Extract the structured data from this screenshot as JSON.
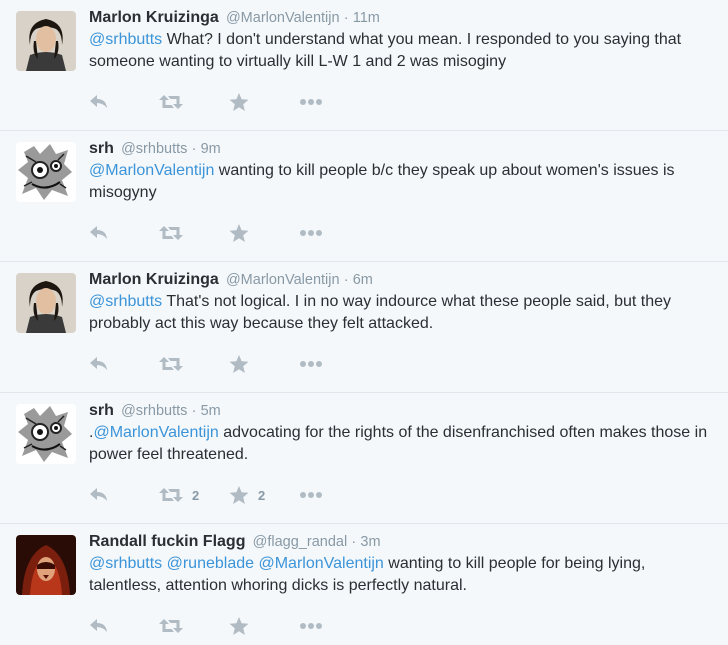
{
  "tweets": [
    {
      "name": "Marlon Kruizinga",
      "handle": "@MarlonValentijn",
      "time": "11m",
      "avatar": "avatar-marlon",
      "segments": [
        {
          "text": "@srhbutts",
          "mention": true
        },
        {
          "text": " What? I don't understand what you mean. I responded to you saying that someone wanting to virtually kill L-W 1 and 2 was misoginy",
          "mention": false
        }
      ],
      "retweets": "",
      "favorites": ""
    },
    {
      "name": "srh",
      "handle": "@srhbutts",
      "time": "9m",
      "avatar": "avatar-srh",
      "segments": [
        {
          "text": "@MarlonValentijn",
          "mention": true
        },
        {
          "text": " wanting to kill people b/c they speak up about women's issues is misogyny",
          "mention": false
        }
      ],
      "retweets": "",
      "favorites": ""
    },
    {
      "name": "Marlon Kruizinga",
      "handle": "@MarlonValentijn",
      "time": "6m",
      "avatar": "avatar-marlon",
      "segments": [
        {
          "text": "@srhbutts",
          "mention": true
        },
        {
          "text": " That's not logical. I in no way indource what these people said, but they probably act this way because they felt attacked.",
          "mention": false
        }
      ],
      "retweets": "",
      "favorites": ""
    },
    {
      "name": "srh",
      "handle": "@srhbutts",
      "time": "5m",
      "avatar": "avatar-srh",
      "segments": [
        {
          "text": ".",
          "mention": false
        },
        {
          "text": "@MarlonValentijn",
          "mention": true
        },
        {
          "text": " advocating for the rights of the disenfranchised often makes those in power feel threatened.",
          "mention": false
        }
      ],
      "retweets": "2",
      "favorites": "2"
    },
    {
      "name": "Randall fuckin Flagg",
      "handle": "@flagg_randal",
      "time": "3m",
      "avatar": "avatar-randall",
      "segments": [
        {
          "text": "@srhbutts",
          "mention": true
        },
        {
          "text": " ",
          "mention": false
        },
        {
          "text": "@runeblade",
          "mention": true
        },
        {
          "text": " ",
          "mention": false
        },
        {
          "text": "@MarlonValentijn",
          "mention": true
        },
        {
          "text": " wanting to kill people for being lying, talentless, attention whoring dicks is perfectly natural.",
          "mention": false
        }
      ],
      "retweets": "",
      "favorites": ""
    }
  ],
  "separator": "·",
  "icons": {
    "reply": "reply-icon",
    "retweet": "retweet-icon",
    "favorite": "star-icon",
    "more": "more-dots-icon"
  },
  "colors": {
    "background": "#f5f8fa",
    "mention": "#3b94d9",
    "meta": "#8899a6",
    "icon": "#b1bbc3",
    "border": "#e1e8ed"
  }
}
